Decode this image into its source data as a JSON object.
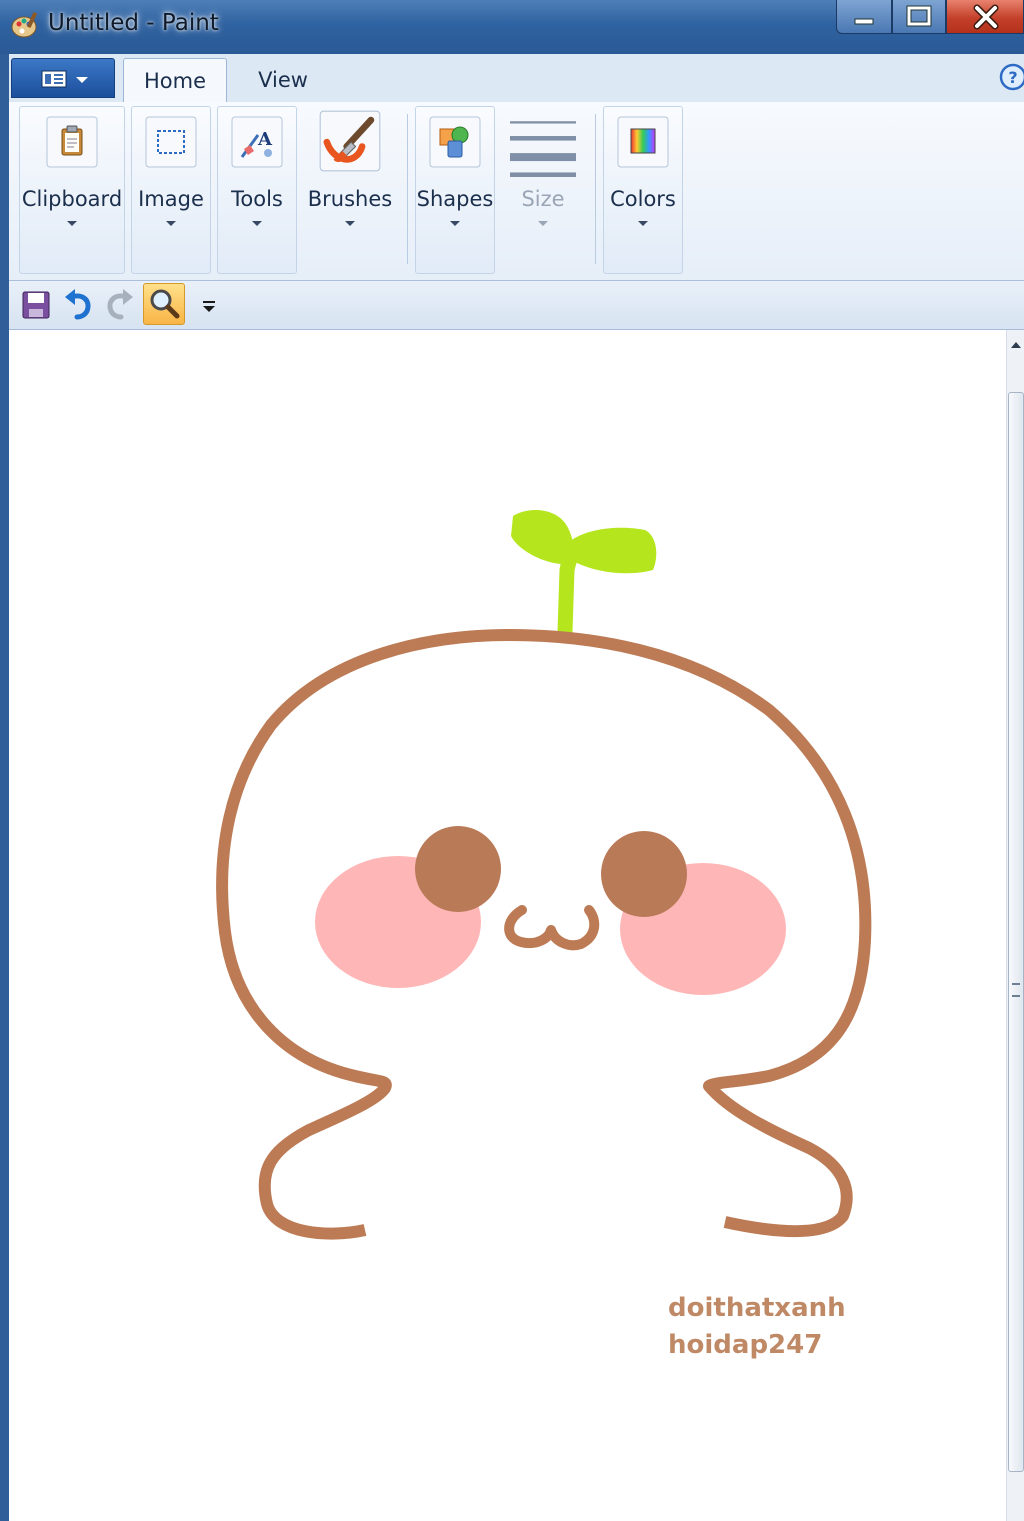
{
  "window": {
    "title": "Untitled - Paint",
    "controls": [
      "minimize",
      "maximize",
      "close"
    ]
  },
  "ribbon": {
    "tabs": [
      {
        "label": "Home",
        "selected": true
      },
      {
        "label": "View",
        "selected": false
      }
    ],
    "groups": [
      {
        "label": "Clipboard",
        "icon": "clipboard-icon",
        "enabled": true
      },
      {
        "label": "Image",
        "icon": "image-select-icon",
        "enabled": true
      },
      {
        "label": "Tools",
        "icon": "tools-icon",
        "enabled": true
      },
      {
        "label": "Brushes",
        "icon": "brush-icon",
        "enabled": true
      },
      {
        "label": "Shapes",
        "icon": "shapes-icon",
        "enabled": true
      },
      {
        "label": "Size",
        "icon": "size-lines-icon",
        "enabled": false
      },
      {
        "label": "Colors",
        "icon": "color-palette-icon",
        "enabled": true
      }
    ]
  },
  "quick_access": [
    {
      "name": "save",
      "icon": "save-icon"
    },
    {
      "name": "undo",
      "icon": "undo-icon"
    },
    {
      "name": "redo",
      "icon": "redo-icon",
      "enabled": false
    },
    {
      "name": "zoom",
      "icon": "magnifier-icon",
      "active": true
    },
    {
      "name": "customize",
      "icon": "dropdown-icon"
    }
  ],
  "canvas": {
    "watermark_line1": "doithatxanh",
    "watermark_line2": "hoidap247",
    "colors": {
      "outline": "#bc7b55",
      "sprout": "#b5e61d",
      "cheeks": "#ffb6b6",
      "eyes": "#b97a57",
      "watermark": "#bf8966"
    }
  }
}
